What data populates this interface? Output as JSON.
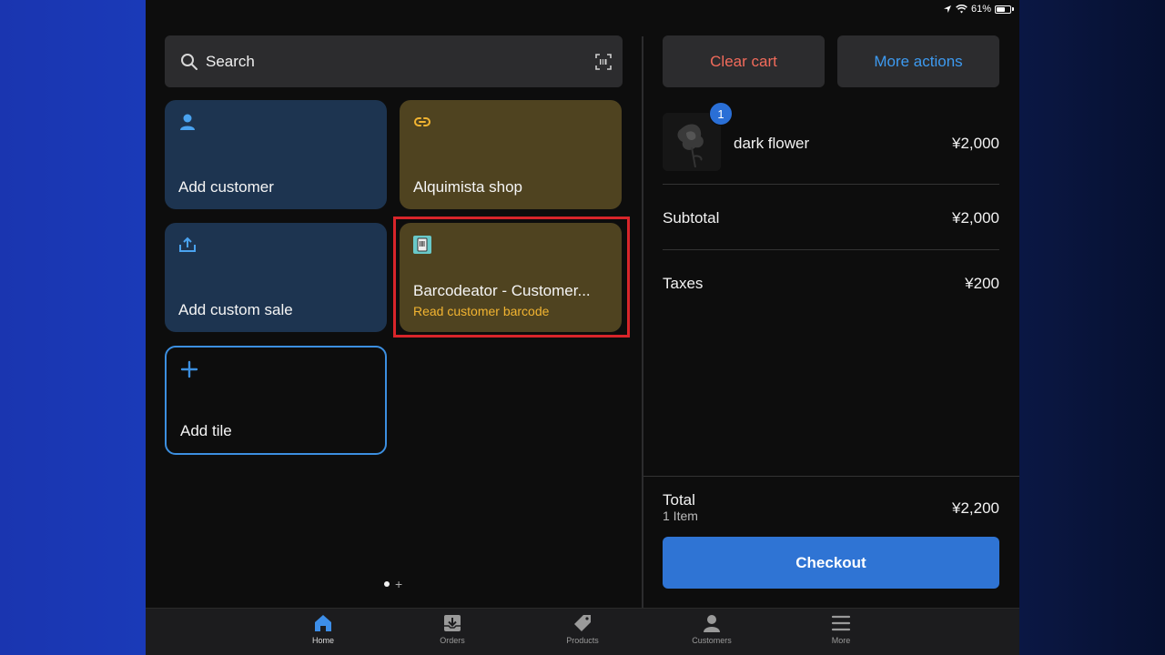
{
  "status_bar": {
    "battery": "61%"
  },
  "search": {
    "label": "Search"
  },
  "tiles": [
    {
      "label": "Add customer",
      "icon": "person-icon",
      "color": "#1d3450"
    },
    {
      "label": "Alquimista shop",
      "icon": "link-icon",
      "color": "#4f4320"
    },
    {
      "label": "Add custom sale",
      "icon": "add-sale-icon",
      "color": "#1d3450"
    },
    {
      "label": "Barcodeator - Customer...",
      "sublabel": "Read customer barcode",
      "icon": "barcode-app-icon",
      "color": "#4f4320",
      "highlighted": true
    },
    {
      "label": "Add tile",
      "icon": "plus-icon",
      "color": "#3c8fe0"
    }
  ],
  "cart": {
    "clear_label": "Clear cart",
    "more_actions_label": "More actions",
    "items": [
      {
        "name": "dark flower",
        "price": "¥2,000",
        "quantity": "1"
      }
    ],
    "subtotal_label": "Subtotal",
    "subtotal_value": "¥2,000",
    "taxes_label": "Taxes",
    "taxes_value": "¥200",
    "total_label": "Total",
    "total_items": "1 Item",
    "total_value": "¥2,200",
    "checkout_label": "Checkout"
  },
  "nav": {
    "tabs": [
      {
        "label": "Home",
        "icon": "home-icon",
        "active": true
      },
      {
        "label": "Orders",
        "icon": "orders-icon"
      },
      {
        "label": "Products",
        "icon": "tag-icon"
      },
      {
        "label": "Customers",
        "icon": "person-icon"
      },
      {
        "label": "More",
        "icon": "menu-icon"
      }
    ]
  },
  "colors": {
    "accent_blue": "#2f74d4",
    "clear_red": "#f26b5b",
    "link_blue": "#3d9af0",
    "highlight_red": "#d8252a",
    "sublabel_yellow": "#f2b431"
  }
}
